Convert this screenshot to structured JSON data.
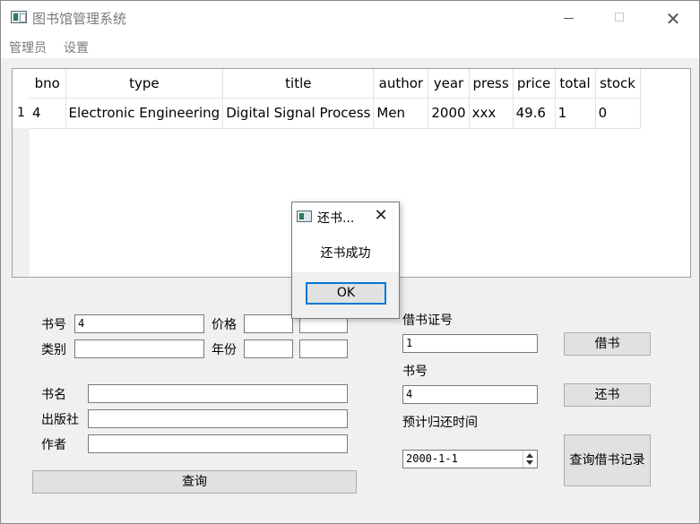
{
  "window": {
    "title": "图书馆管理系统",
    "min_label": "—",
    "max_label": "",
    "close_label": "✕"
  },
  "menu": [
    "管理员",
    "设置"
  ],
  "table": {
    "columns": [
      "bno",
      "type",
      "title",
      "author",
      "year",
      "press",
      "price",
      "total",
      "stock"
    ],
    "rows": [
      {
        "num": "1",
        "cells": [
          "4",
          "Electronic Engineering",
          "Digital Signal Process",
          "Men",
          "2000",
          "xxx",
          "49.6",
          "1",
          "0"
        ]
      }
    ]
  },
  "search": {
    "bno_label": "书号",
    "bno_value": "4",
    "price_label": "价格",
    "price_min": "",
    "price_max": "",
    "type_label": "类别",
    "type_value": "",
    "year_label": "年份",
    "year_min": "",
    "year_max": "",
    "title_label": "书名",
    "title_value": "",
    "press_label": "出版社",
    "press_value": "",
    "author_label": "作者",
    "author_value": "",
    "query_button": "查询"
  },
  "borrow": {
    "card_label": "借书证号",
    "card_value": "1",
    "bno_label": "书号",
    "bno_value": "4",
    "due_label": "预计归还时间",
    "due_value": "2000-1-1",
    "borrow_button": "借书",
    "return_button": "还书",
    "records_button": "查询借书记录"
  },
  "dialog": {
    "title": "还书...",
    "message": "还书成功",
    "ok_label": "OK",
    "close_label": "✕"
  }
}
